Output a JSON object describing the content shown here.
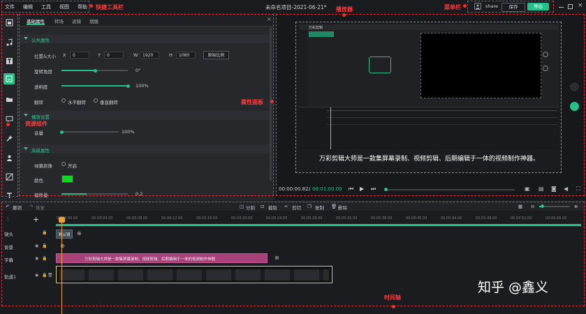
{
  "menu": [
    "文件",
    "编辑",
    "工具",
    "视图",
    "帮助"
  ],
  "project_title": "未命名项目-2021-06-21*",
  "top_buttons": {
    "share": "share",
    "save": "保存",
    "export": "导出"
  },
  "annotations": {
    "quick_toolbar": "快捷工具栏",
    "player": "播放器",
    "menubar": "菜单栏",
    "property_panel": "属性面板",
    "resource_component": "资源组件",
    "timeline": "时间轴"
  },
  "panel": {
    "tabs": [
      "基础属性",
      "转场",
      "滤镜",
      "烟酸"
    ],
    "sections": {
      "common": "公共属性",
      "playback": "播放设置",
      "advanced": "高级属性"
    },
    "labels": {
      "pos_size": "位置&大小",
      "x": "X",
      "y": "Y",
      "w": "W",
      "h": "H",
      "rotation": "旋转角度",
      "opacity": "透明度",
      "flip": "翻转",
      "flip_h": "水平翻转",
      "flip_v": "垂直翻转",
      "volume": "音量",
      "chroma": "绿幕抠像",
      "chroma_on": "开启",
      "color": "颜色",
      "partial": "偏移量"
    },
    "values": {
      "x": "0",
      "y": "0",
      "w": "1920",
      "h": "1080",
      "ratio_button": "原始比例",
      "rotation": "0°",
      "opacity": "100%",
      "volume": "100%",
      "partial": "0.2"
    },
    "sliders": {
      "rotation": 0.5,
      "opacity": 1.0,
      "volume": 0.0
    }
  },
  "preview": {
    "subtitle": "万彩剪辑大师是一款集屏幕录制、视频剪辑、后期编辑于一体的视频制作神器。",
    "inner_caption": "万彩剪辑"
  },
  "player_controls": {
    "current": "00:00:00.82",
    "total": "00:01:00.00",
    "separator": "/",
    "progress": 0.0
  },
  "timeline_toolbar": {
    "undo": "撤销",
    "redo": "恢复",
    "split": "分割",
    "crop": "截取",
    "cut": "剪切",
    "copy": "复制",
    "delete": "删除"
  },
  "ruler": [
    "00:00:00.00",
    "00:00:04.00",
    "00:00:08.00",
    "00:00:12.00",
    "00:00:16.00",
    "00:00:20.00",
    "00:00:24.00",
    "00:00:28.00",
    "00:00:32.00",
    "00:00:36.00",
    "00:00:40.00",
    "00:00:44.00",
    "00:00:48.00",
    "00:00:52.00",
    "00:00:56.00"
  ],
  "tracks": [
    "镜头",
    "背景",
    "字幕",
    "轨道1"
  ],
  "clips": {
    "scene": "默认镜",
    "subtitle": "万彩剪辑大师是一款集屏幕录制、视频剪辑、后期编辑于一体的视频制作神器"
  },
  "watermark": "知乎 @鑫义",
  "colors": {
    "accent": "#28c08a",
    "annotation": "#e0313a",
    "subtitle_clip": "#a8407a",
    "video_border": "#d9d23a"
  }
}
